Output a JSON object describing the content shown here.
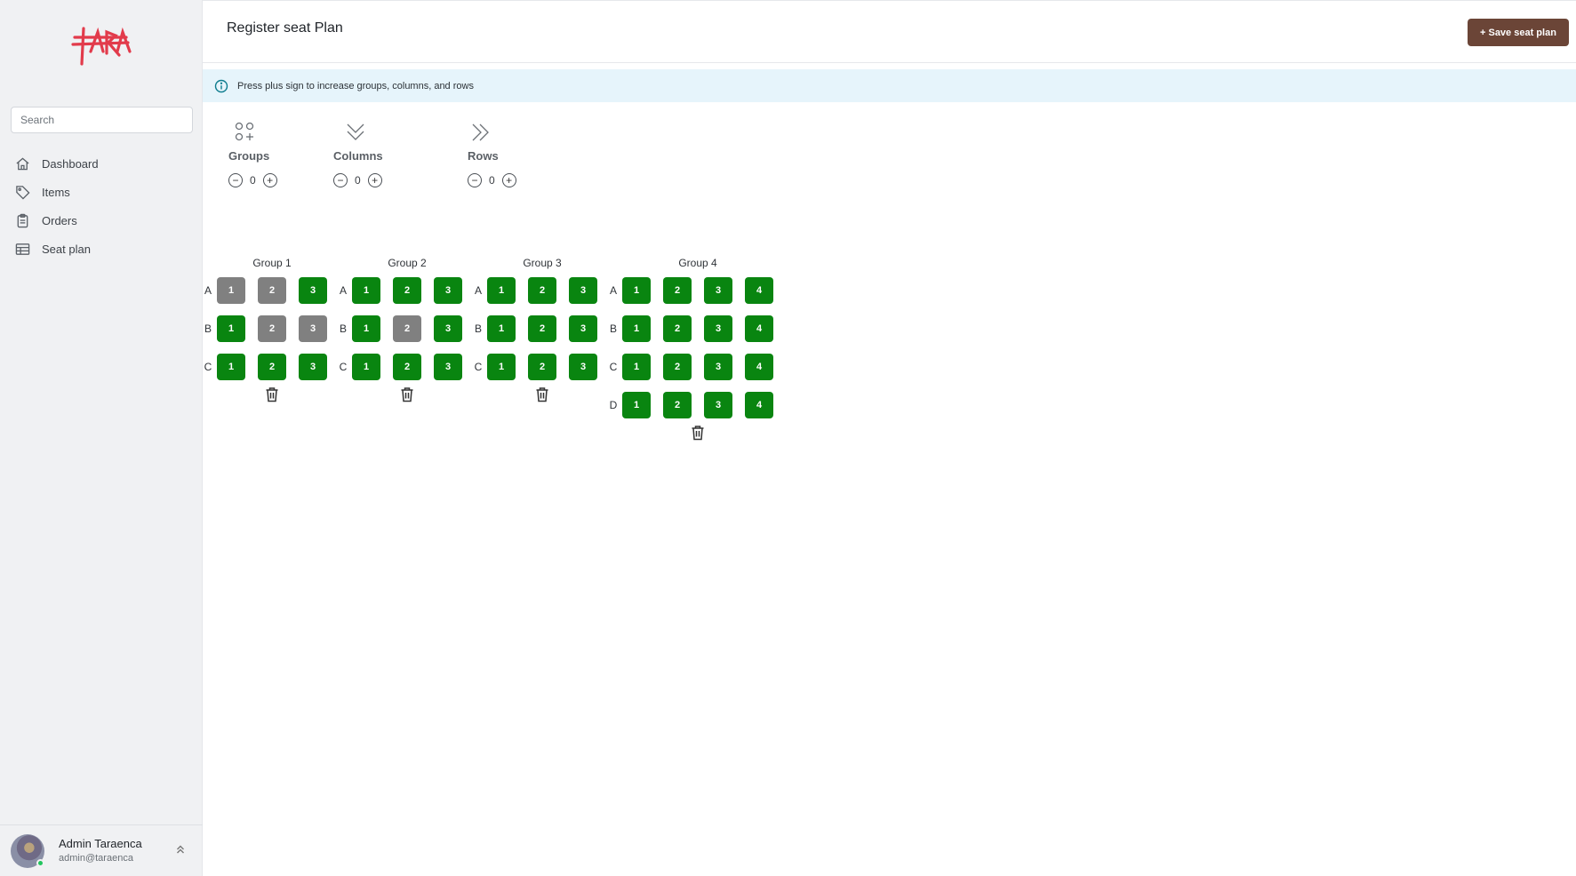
{
  "sidebar": {
    "search_placeholder": "Search",
    "items": [
      {
        "label": "Dashboard",
        "icon": "home-icon"
      },
      {
        "label": "Items",
        "icon": "tag-icon"
      },
      {
        "label": "Orders",
        "icon": "clipboard-icon"
      },
      {
        "label": "Seat plan",
        "icon": "table-icon"
      }
    ],
    "user": {
      "name": "Admin Taraenca",
      "email": "admin@taraenca"
    }
  },
  "header": {
    "title": "Register seat Plan",
    "save_label": "+ Save seat plan"
  },
  "info": {
    "text": "Press plus sign to increase groups, columns, and rows"
  },
  "controls": [
    {
      "label": "Groups",
      "value": "0",
      "icon": "grid-plus-icon"
    },
    {
      "label": "Columns",
      "value": "0",
      "icon": "chevrons-down-icon"
    },
    {
      "label": "Rows",
      "value": "0",
      "icon": "chevrons-right-icon"
    }
  ],
  "colors": {
    "seat_available": "#098510",
    "seat_unavailable": "#808080",
    "save_button": "#6b4537"
  },
  "groups": [
    {
      "title": "Group 1",
      "rows": [
        {
          "label": "A",
          "seats": [
            {
              "n": "1",
              "on": false
            },
            {
              "n": "2",
              "on": false
            },
            {
              "n": "3",
              "on": true
            }
          ]
        },
        {
          "label": "B",
          "seats": [
            {
              "n": "1",
              "on": true
            },
            {
              "n": "2",
              "on": false
            },
            {
              "n": "3",
              "on": false
            }
          ]
        },
        {
          "label": "C",
          "seats": [
            {
              "n": "1",
              "on": true
            },
            {
              "n": "2",
              "on": true
            },
            {
              "n": "3",
              "on": true
            }
          ]
        }
      ]
    },
    {
      "title": "Group 2",
      "rows": [
        {
          "label": "A",
          "seats": [
            {
              "n": "1",
              "on": true
            },
            {
              "n": "2",
              "on": true
            },
            {
              "n": "3",
              "on": true
            }
          ]
        },
        {
          "label": "B",
          "seats": [
            {
              "n": "1",
              "on": true
            },
            {
              "n": "2",
              "on": false
            },
            {
              "n": "3",
              "on": true
            }
          ]
        },
        {
          "label": "C",
          "seats": [
            {
              "n": "1",
              "on": true
            },
            {
              "n": "2",
              "on": true
            },
            {
              "n": "3",
              "on": true
            }
          ]
        }
      ]
    },
    {
      "title": "Group 3",
      "rows": [
        {
          "label": "A",
          "seats": [
            {
              "n": "1",
              "on": true
            },
            {
              "n": "2",
              "on": true
            },
            {
              "n": "3",
              "on": true
            }
          ]
        },
        {
          "label": "B",
          "seats": [
            {
              "n": "1",
              "on": true
            },
            {
              "n": "2",
              "on": true
            },
            {
              "n": "3",
              "on": true
            }
          ]
        },
        {
          "label": "C",
          "seats": [
            {
              "n": "1",
              "on": true
            },
            {
              "n": "2",
              "on": true
            },
            {
              "n": "3",
              "on": true
            }
          ]
        }
      ]
    },
    {
      "title": "Group 4",
      "rows": [
        {
          "label": "A",
          "seats": [
            {
              "n": "1",
              "on": true
            },
            {
              "n": "2",
              "on": true
            },
            {
              "n": "3",
              "on": true
            },
            {
              "n": "4",
              "on": true
            }
          ]
        },
        {
          "label": "B",
          "seats": [
            {
              "n": "1",
              "on": true
            },
            {
              "n": "2",
              "on": true
            },
            {
              "n": "3",
              "on": true
            },
            {
              "n": "4",
              "on": true
            }
          ]
        },
        {
          "label": "C",
          "seats": [
            {
              "n": "1",
              "on": true
            },
            {
              "n": "2",
              "on": true
            },
            {
              "n": "3",
              "on": true
            },
            {
              "n": "4",
              "on": true
            }
          ]
        },
        {
          "label": "D",
          "seats": [
            {
              "n": "1",
              "on": true
            },
            {
              "n": "2",
              "on": true
            },
            {
              "n": "3",
              "on": true
            },
            {
              "n": "4",
              "on": true
            }
          ]
        }
      ]
    }
  ]
}
